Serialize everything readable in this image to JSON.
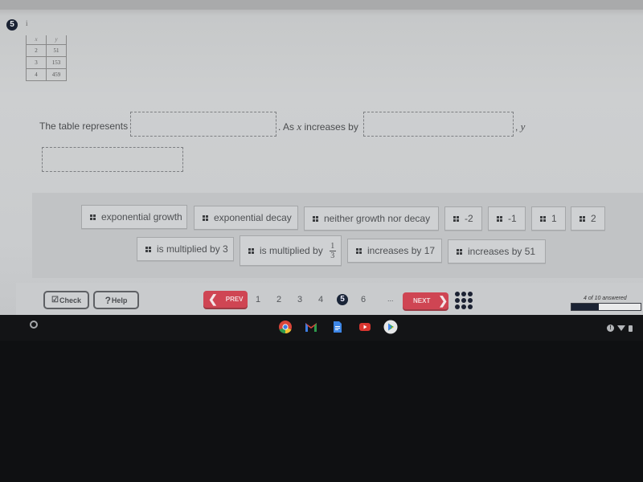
{
  "question": {
    "number": "5",
    "sub_label": "i",
    "table": {
      "headers": [
        "x",
        "y"
      ],
      "rows": [
        [
          "2",
          "51"
        ],
        [
          "3",
          "153"
        ],
        [
          "4",
          "459"
        ]
      ]
    },
    "prompt_part1": "The table represents",
    "prompt_part2_pre": "As ",
    "prompt_part2_var": "x",
    "prompt_part2_post": " increases by",
    "prompt_part3_var": "y",
    "dropzone_1_value": "",
    "dropzone_2_value": "",
    "dropzone_3_value": ""
  },
  "answer_choices": [
    "exponential growth",
    "exponential decay",
    "neither growth nor decay",
    "-2",
    "-1",
    "1",
    "2",
    "is multiplied by 3",
    "is multiplied by",
    "increases by 17",
    "increases by 51"
  ],
  "fraction_choice": {
    "numerator": "1",
    "denominator": "3"
  },
  "footer": {
    "check_label": "Check",
    "help_label": "Help",
    "prev_label": "PREV",
    "next_label": "NEXT",
    "pages": [
      "1",
      "2",
      "3",
      "4",
      "5",
      "6",
      "..."
    ],
    "current_page": "5",
    "answered_text": "4 of 10 answered",
    "progress_fraction": 0.4,
    "colors": {
      "accent_red": "#cf4553",
      "navy": "#1a2233"
    }
  },
  "shelf": {
    "apps": [
      "chrome-icon",
      "gmail-icon",
      "docs-icon",
      "youtube-icon",
      "play-store-icon"
    ]
  }
}
